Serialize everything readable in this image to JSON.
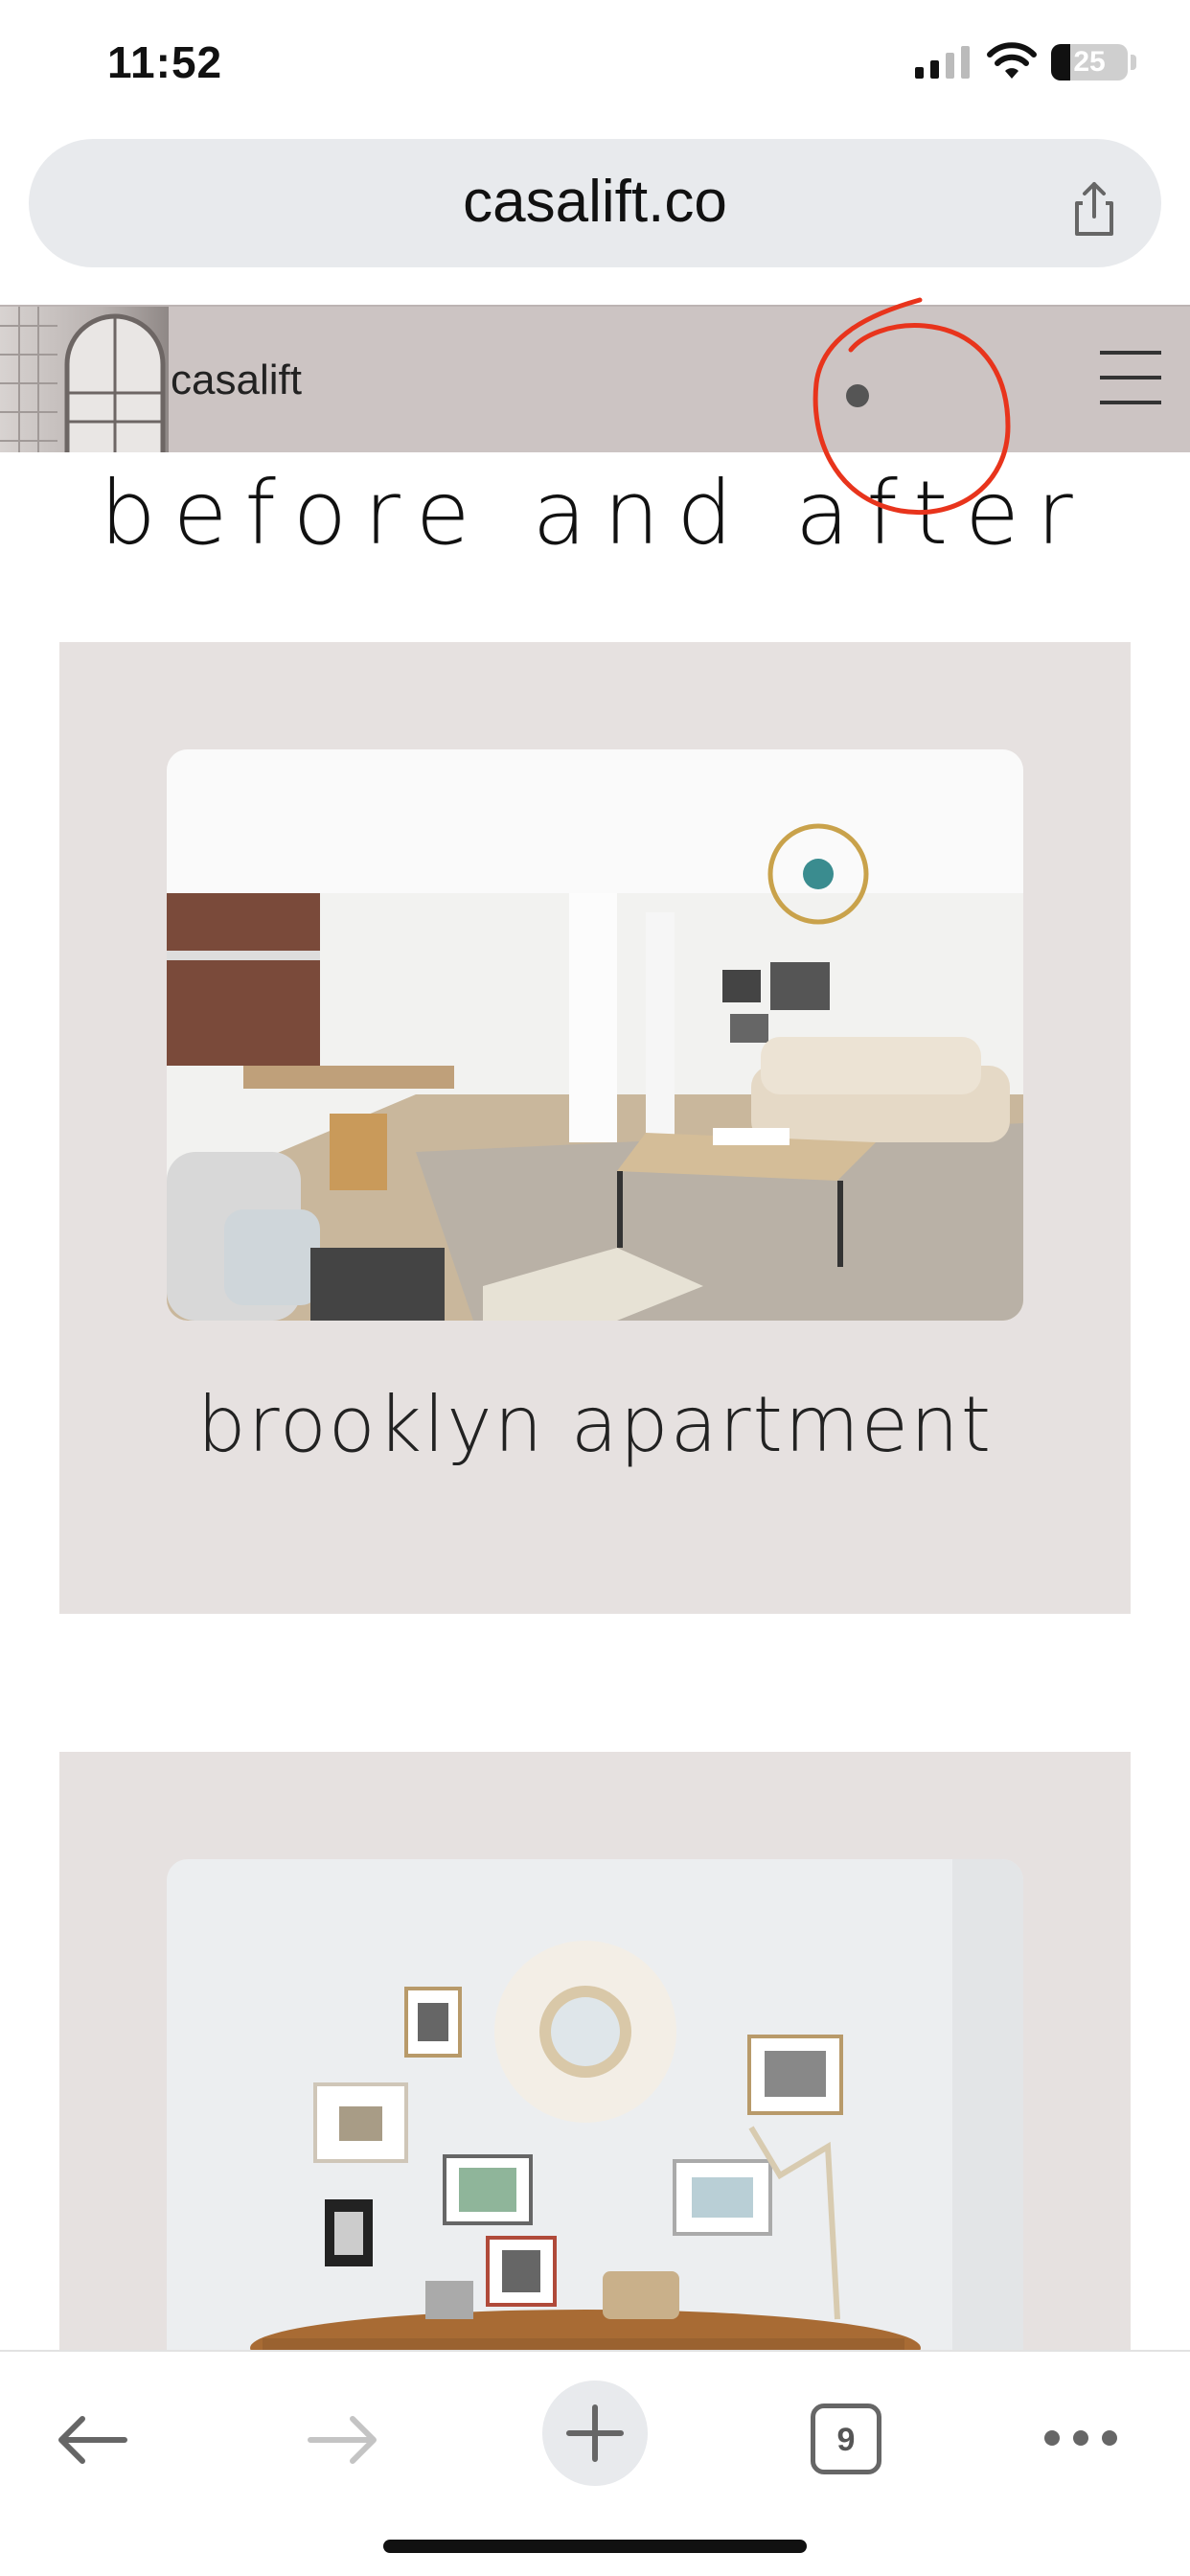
{
  "status_bar": {
    "time": "11:52",
    "battery": "25",
    "battery_level": 0.25
  },
  "browser": {
    "url": "casalift.co",
    "open_tabs": "9"
  },
  "site": {
    "brand": "casalift",
    "heading": "before and after",
    "cards": [
      {
        "title": "brooklyn apartment"
      },
      {
        "title": ""
      }
    ]
  },
  "icons": [
    "cellular-signal-icon",
    "wifi-icon",
    "battery-icon",
    "share-icon",
    "menu-icon",
    "back-arrow-icon",
    "forward-arrow-icon",
    "plus-icon",
    "tabs-icon",
    "more-icon"
  ],
  "colors": {
    "header_bg": "#ccc4c3",
    "card_bg": "#e6e1e0",
    "annotation": "#e8341c",
    "url_bar_bg": "#e8eaed"
  }
}
